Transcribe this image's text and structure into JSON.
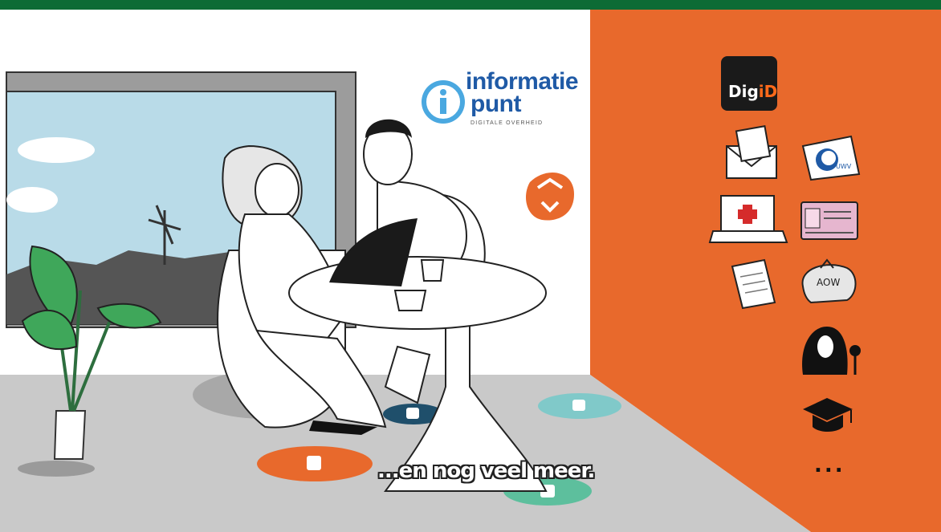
{
  "brand": {
    "name": "informatie punt",
    "line1": "informatie",
    "line2": "punt",
    "tagline": "DIGITALE OVERHEID",
    "color": "#1f5aa6"
  },
  "header_bar": {
    "color": "#0d6b35"
  },
  "wall_right": {
    "color": "#e8692c"
  },
  "icons": {
    "digid": {
      "label_part1": "Dig",
      "label_part2": "iD",
      "icon": "digid-icon"
    },
    "uwv": {
      "label": "UWV",
      "icon": "uwv-folder-icon"
    },
    "aow": {
      "label": "AOW",
      "icon": "aow-moneybag-icon"
    },
    "mail": {
      "icon": "mail-envelope-icon"
    },
    "health": {
      "icon": "laptop-medical-cross-icon"
    },
    "id_card": {
      "icon": "id-card-icon"
    },
    "document": {
      "icon": "document-icon"
    },
    "person": {
      "icon": "person-with-flower-icon"
    },
    "education": {
      "icon": "graduation-cap-icon"
    },
    "more": {
      "label": "...",
      "icon": "more-dots-icon"
    }
  },
  "subtitle": "...en nog veel meer."
}
